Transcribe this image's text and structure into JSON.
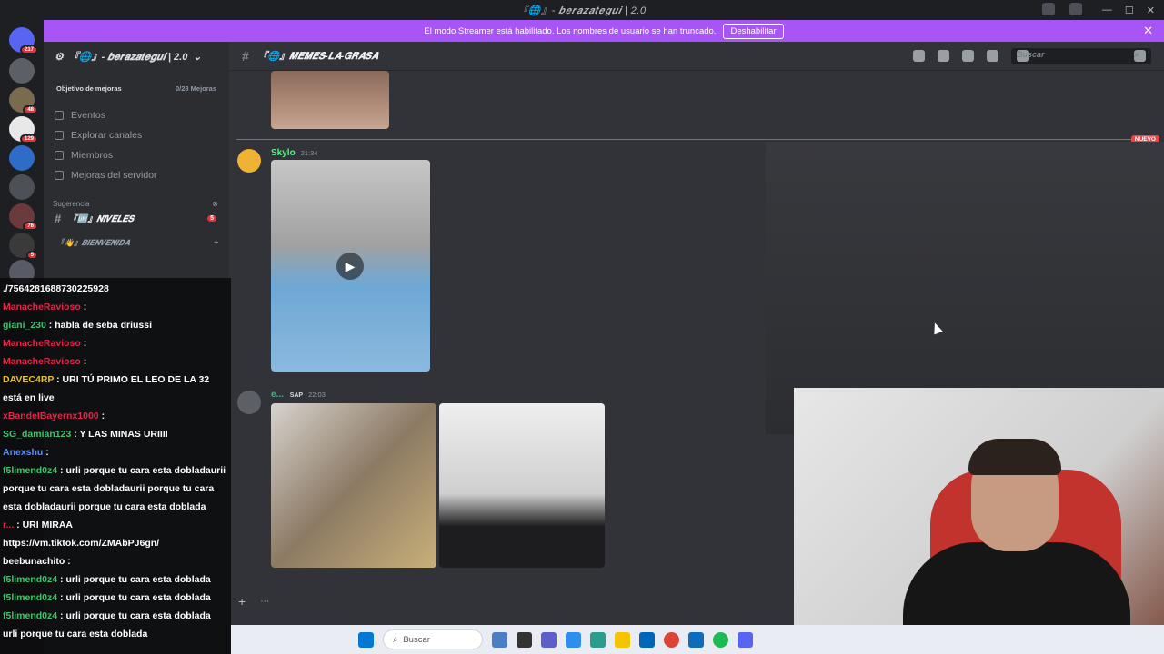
{
  "window": {
    "title": "『🌐』- 𝒃𝒆𝒓𝒂𝒛𝒂𝒕𝒆𝒈𝒖𝒊 | 2.0",
    "controls": [
      "—",
      "☐",
      "✕"
    ]
  },
  "banner": {
    "text": "El modo Streamer está habilitado. Los nombres de usuario se han truncado.",
    "button": "Deshabilitar",
    "close": "✕"
  },
  "guilds": [
    {
      "badge": "217"
    },
    {
      "badge": ""
    },
    {
      "badge": "48"
    },
    {
      "badge": "129"
    },
    {
      "badge": ""
    },
    {
      "badge": ""
    },
    {
      "badge": "76"
    },
    {
      "badge": "5"
    },
    {
      "badge": ""
    }
  ],
  "server": {
    "name": "『🌐』- 𝒃𝒆𝒓𝒂𝒛𝒂𝒕𝒆𝒈𝒖𝒊 | 2.0",
    "boost_label": "Objetivo de mejoras",
    "boost_count": "0/28 Mejoras",
    "nav": [
      "Eventos",
      "Explorar canales",
      "Miembros",
      "Mejoras del servidor"
    ],
    "suggestion_label": "Sugerencia",
    "suggestion_channel": "『🆙』𝑵𝑰𝑽𝑬𝑳𝑬𝑺",
    "suggestion_badge": "5",
    "category": "『👋』𝑩𝑰𝑬𝑵𝑽𝑬𝑵𝑰𝑫𝑨"
  },
  "channel": {
    "name": "『🌐』𝑴𝑬𝑴𝑬𝑺-𝑳𝑨-𝑮𝑹𝑨𝑺𝑨",
    "search_placeholder": "Buscar",
    "new_label": "NUEVO"
  },
  "messages": [
    {
      "author": "Skylo",
      "time": "21:34",
      "color": "#57f287"
    },
    {
      "author": "e...",
      "tag": "SAP",
      "time": "22:03",
      "color": "#43b581"
    }
  ],
  "chat": [
    {
      "user": "",
      "text": "./7564281688730225928",
      "color": "#ffffff"
    },
    {
      "user": "ManacheRavioso",
      "text": " :",
      "color": "#e0274b"
    },
    {
      "user": "giani_230",
      "text": " : habla de seba driussi",
      "color": "#3ec46d"
    },
    {
      "user": "ManacheRavioso",
      "text": " :",
      "color": "#e0274b"
    },
    {
      "user": "ManacheRavioso",
      "text": " :",
      "color": "#e0274b"
    },
    {
      "user": "DAVEC4RP",
      "text": " : URI TÚ PRIMO EL LEO DE LA 32 está en live",
      "color": "#e6c229"
    },
    {
      "user": "xBandeIBayernx1000",
      "text": " :",
      "color": "#e0274b"
    },
    {
      "user": "SG_damian123",
      "text": " : Y LAS MINAS URIIII",
      "color": "#3ec46d"
    },
    {
      "user": "Anexshu",
      "text": " :",
      "color": "#5b8df0"
    },
    {
      "user": "f5limend0z4",
      "text": " : urli porque tu cara esta dobladaurii porque tu cara esta dobladaurii porque tu cara esta dobladaurii porque tu cara esta doblada",
      "color": "#3ec46d"
    },
    {
      "user": "r...",
      "text": " : URI MIRAA https://vm.tiktok.com/ZMAbPJ6gn/",
      "color": "#e0274b"
    },
    {
      "user": "beebunachito",
      "text": " :",
      "color": "#ffffff"
    },
    {
      "user": "f5limend0z4",
      "text": " : urli porque tu cara esta doblada",
      "color": "#3ec46d"
    },
    {
      "user": "f5limend0z4",
      "text": " : urli porque tu cara esta doblada",
      "color": "#3ec46d"
    },
    {
      "user": "f5limend0z4",
      "text": " : urli porque tu cara esta doblada",
      "color": "#3ec46d"
    },
    {
      "user": "",
      "text": "urli porque tu cara esta doblada",
      "color": "#ffffff"
    }
  ],
  "taskbar": {
    "search": "Buscar"
  }
}
